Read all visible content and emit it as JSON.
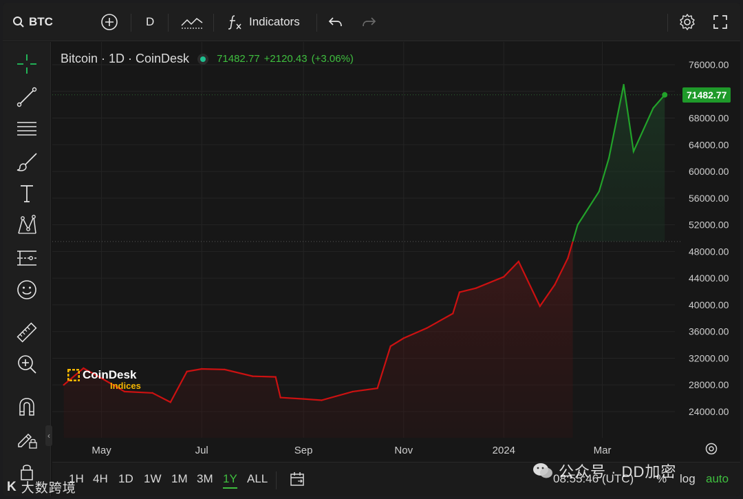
{
  "toolbar": {
    "symbol": "BTC",
    "interval": "D",
    "indicators_label": "Indicators"
  },
  "legend": {
    "title": "Bitcoin · 1D · CoinDesk",
    "last": "71482.77",
    "change": "+2120.43",
    "change_pct": "(+3.06%)"
  },
  "price_axis": {
    "ticks": [
      "76000.00",
      "68000.00",
      "64000.00",
      "60000.00",
      "56000.00",
      "52000.00",
      "48000.00",
      "44000.00",
      "40000.00",
      "36000.00",
      "32000.00",
      "28000.00",
      "24000.00"
    ],
    "current_label": "71482.77"
  },
  "time_axis": {
    "ticks": [
      "May",
      "Jul",
      "Sep",
      "Nov",
      "2024",
      "Mar"
    ]
  },
  "watermark_logo": {
    "line1": "CoinDesk",
    "line2": "Indices"
  },
  "ranges": [
    "1H",
    "4H",
    "1D",
    "1W",
    "1M",
    "3M",
    "1Y",
    "ALL"
  ],
  "active_range": "1Y",
  "status": {
    "time": "08:55:46 (UTC)",
    "percent": "%",
    "log": "log",
    "auto": "auto"
  },
  "overlay_text": {
    "wechat": "公众号 · DD加密",
    "corner": "大数跨境"
  },
  "colors": {
    "up": "#22a22a",
    "down": "#cc1111",
    "background": "#171717",
    "grid": "#262626"
  },
  "chart_data": {
    "type": "line",
    "title": "Bitcoin · 1D · CoinDesk",
    "xlabel": "",
    "ylabel": "",
    "ylim": [
      22000,
      78000
    ],
    "x_ticks": [
      "May",
      "Jul",
      "Sep",
      "Nov",
      "2024",
      "Mar"
    ],
    "baseline": 49500,
    "series": [
      {
        "name": "",
        "x": [
          "2023-04-08",
          "2023-04-20",
          "2023-05-01",
          "2023-05-15",
          "2023-06-01",
          "2023-06-12",
          "2023-06-22",
          "2023-07-01",
          "2023-07-15",
          "2023-08-01",
          "2023-08-15",
          "2023-08-18",
          "2023-09-01",
          "2023-09-12",
          "2023-10-01",
          "2023-10-16",
          "2023-10-24",
          "2023-11-01",
          "2023-11-15",
          "2023-12-01",
          "2023-12-05",
          "2023-12-15",
          "2024-01-01",
          "2024-01-10",
          "2024-01-23",
          "2024-02-01",
          "2024-02-09",
          "2024-02-15",
          "2024-02-28",
          "2024-03-05",
          "2024-03-14",
          "2024-03-20",
          "2024-04-01",
          "2024-04-08"
        ],
        "values": [
          28000,
          30500,
          29000,
          27000,
          26800,
          25400,
          30000,
          30400,
          30300,
          29300,
          29200,
          26100,
          25900,
          25700,
          27000,
          27500,
          33800,
          35000,
          36500,
          38700,
          41900,
          42500,
          44200,
          46500,
          39800,
          43000,
          47000,
          52000,
          57000,
          62000,
          73000,
          63000,
          69500,
          71482.77
        ]
      }
    ]
  }
}
